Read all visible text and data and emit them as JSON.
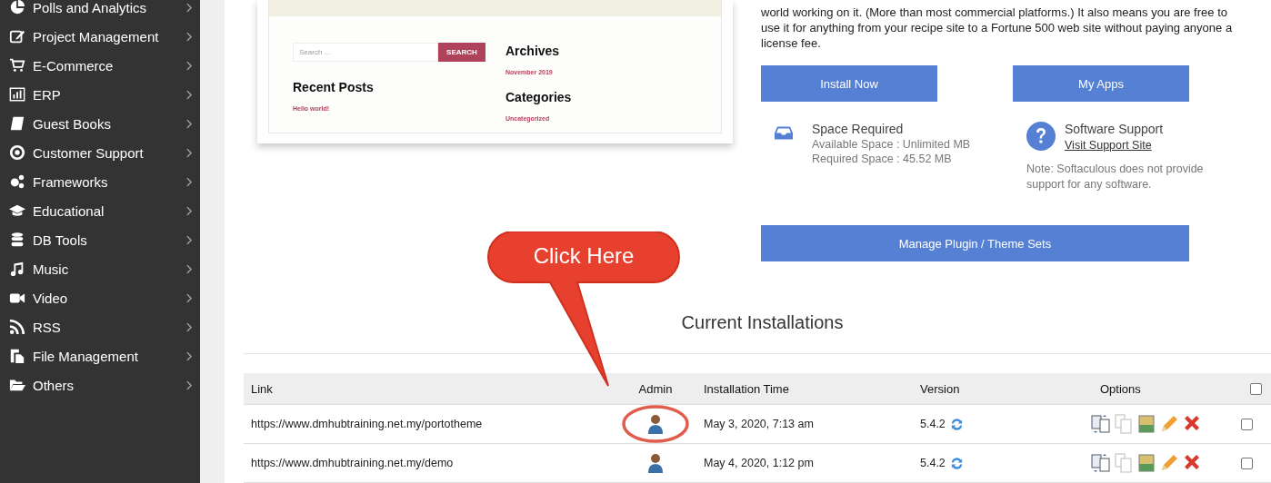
{
  "sidebar": {
    "items": [
      {
        "label": "Polls and Analytics"
      },
      {
        "label": "Project Management"
      },
      {
        "label": "E-Commerce"
      },
      {
        "label": "ERP"
      },
      {
        "label": "Guest Books"
      },
      {
        "label": "Customer Support"
      },
      {
        "label": "Frameworks"
      },
      {
        "label": "Educational"
      },
      {
        "label": "DB Tools"
      },
      {
        "label": "Music"
      },
      {
        "label": "Video"
      },
      {
        "label": "RSS"
      },
      {
        "label": "File Management"
      },
      {
        "label": "Others"
      }
    ]
  },
  "preview": {
    "search_placeholder": "Search ...",
    "search_button": "SEARCH",
    "recent_posts_heading": "Recent Posts",
    "recent_posts": [
      "Hello world!"
    ],
    "archives_heading": "Archives",
    "archives": [
      "November 2019"
    ],
    "categories_heading": "Categories",
    "categories": [
      "Uncategorized"
    ]
  },
  "info": {
    "paragraph": "world working on it. (More than most commercial platforms.) It also means you are free to use it for anything from your recipe site to a Fortune 500 web site without paying anyone a license fee.",
    "install_button": "Install Now",
    "my_apps_button": "My Apps",
    "space": {
      "title": "Space Required",
      "available": "Available Space : Unlimited MB",
      "required": "Required Space : 45.52 MB"
    },
    "support": {
      "title": "Software Support",
      "link": "Visit Support Site",
      "note": "Note: Softaculous does not provide support for any software."
    },
    "manage_button": "Manage Plugin / Theme Sets"
  },
  "installations": {
    "title": "Current Installations",
    "columns": [
      "Link",
      "Admin",
      "Installation Time",
      "Version",
      "Options"
    ],
    "select_all": {
      "checked": false
    },
    "rows": [
      {
        "link": "https://www.dmhubtraining.net.my/portotheme",
        "time": "May 3, 2020, 7:13 am",
        "version": "5.4.2",
        "checked": false,
        "highlighted": true
      },
      {
        "link": "https://www.dmhubtraining.net.my/demo",
        "time": "May 4, 2020, 1:12 pm",
        "version": "5.4.2",
        "checked": false,
        "highlighted": false
      }
    ]
  },
  "callout": {
    "text": "Click Here"
  }
}
